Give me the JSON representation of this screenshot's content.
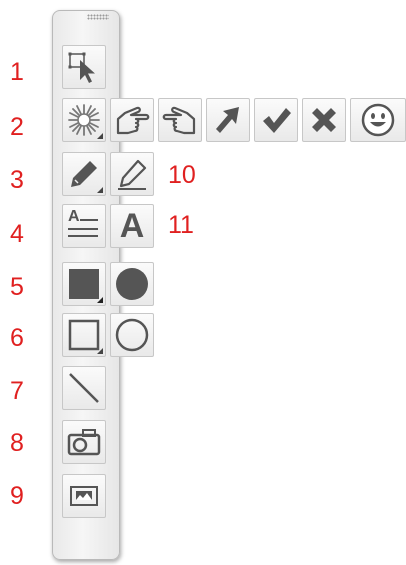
{
  "palette": {
    "numbers": [
      "1",
      "2",
      "3",
      "4",
      "5",
      "6",
      "7",
      "8",
      "9",
      "10",
      "11"
    ],
    "tools": {
      "row1": [
        "select-icon"
      ],
      "row2": [
        "burst-icon",
        "hand-pointer-outline-icon",
        "hand-pointer-left-icon",
        "arrow-icon",
        "checkmark-icon",
        "cross-icon",
        "smiley-icon"
      ],
      "row3": [
        "pencil-icon",
        "pencil-outline-icon"
      ],
      "row4": [
        "text-block-icon",
        "text-icon"
      ],
      "row5": [
        "filled-rectangle-icon",
        "filled-circle-icon"
      ],
      "row6": [
        "outline-rectangle-icon",
        "outline-circle-icon"
      ],
      "row7": [
        "line-icon"
      ],
      "row8": [
        "camera-icon"
      ],
      "row9": [
        "image-placeholder-icon"
      ]
    },
    "text_block_glyph": "A",
    "text_glyph": "A",
    "colors": {
      "number": "#e02020",
      "icon": "#555555",
      "icon_dark": "#3a3a3a"
    }
  }
}
